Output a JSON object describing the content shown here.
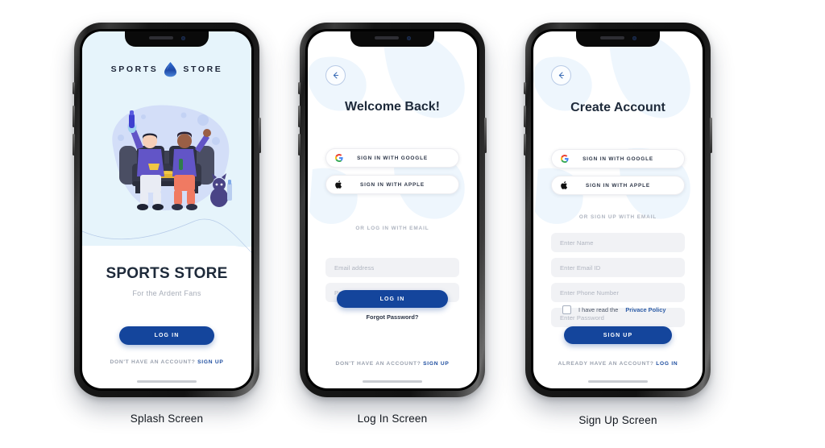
{
  "brand": {
    "accent_blue": "#14459C",
    "light_blue_bg": "#E6F4FB",
    "link_blue": "#1B4B9E",
    "dark_text": "#1E2A3A",
    "muted_text": "#9AA1AE"
  },
  "screens": [
    {
      "caption": "Splash Screen",
      "logo": {
        "left_word": "SPORTS",
        "icon": "droplet-shield-icon",
        "right_word": "STORE"
      },
      "title": "SPORTS STORE",
      "subtitle": "For the Ardent Fans",
      "cta": "LOG IN",
      "footer": {
        "text": "DON'T HAVE AN ACCOUNT?",
        "link": "SIGN UP"
      }
    },
    {
      "caption": "Log In Screen",
      "back_icon": "arrow-left-icon",
      "title": "Welcome Back!",
      "social": [
        {
          "icon": "google-icon",
          "label": "SIGN IN WITH GOOGLE"
        },
        {
          "icon": "apple-icon",
          "label": "SIGN IN WITH APPLE"
        }
      ],
      "divider": "OR LOG IN WITH EMAIL",
      "fields": [
        {
          "name": "email",
          "placeholder": "Email address",
          "value": ""
        },
        {
          "name": "password",
          "placeholder": "Password",
          "value": ""
        }
      ],
      "cta": "LOG IN",
      "forgot": "Forgot Password?",
      "footer": {
        "text": "DON'T HAVE AN ACCOUNT?",
        "link": "SIGN UP"
      }
    },
    {
      "caption": "Sign Up Screen",
      "back_icon": "arrow-left-icon",
      "title": "Create Account",
      "social": [
        {
          "icon": "google-icon",
          "label": "SIGN IN WITH GOOGLE"
        },
        {
          "icon": "apple-icon",
          "label": "SIGN IN WITH APPLE"
        }
      ],
      "divider": "OR SIGN UP WITH EMAIL",
      "fields": [
        {
          "name": "name",
          "placeholder": "Enter Name",
          "value": ""
        },
        {
          "name": "email",
          "placeholder": "Enter Email ID",
          "value": ""
        },
        {
          "name": "phone",
          "placeholder": "Enter Phone Number",
          "value": ""
        },
        {
          "name": "password",
          "placeholder": "Enter Password",
          "value": ""
        }
      ],
      "consent": {
        "checked": false,
        "text": "I have read the",
        "link": "Privace Policy"
      },
      "cta": "SIGN UP",
      "footer": {
        "text": "ALREADY HAVE AN ACCOUNT?",
        "link": "LOG IN"
      }
    }
  ]
}
